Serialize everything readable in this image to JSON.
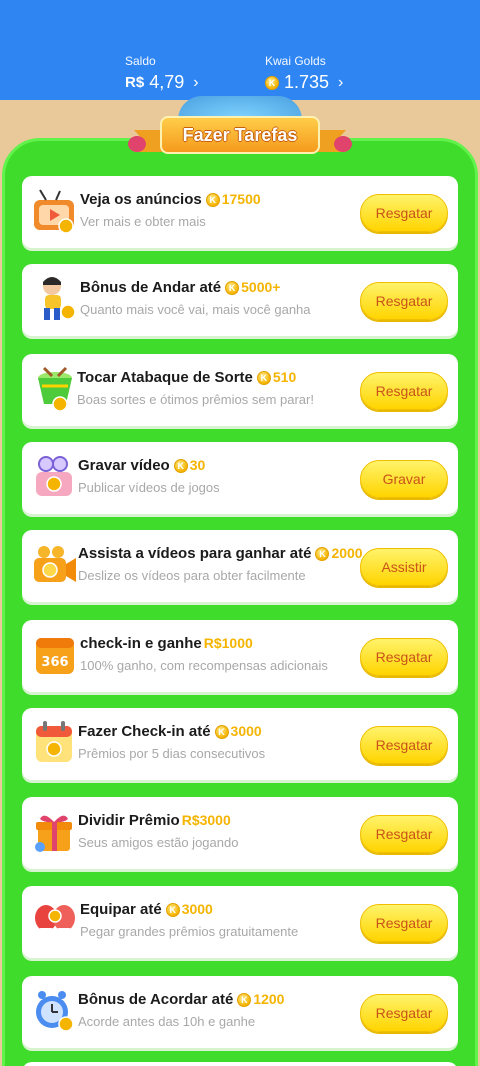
{
  "header": {
    "saldo_label": "Saldo",
    "saldo_currency": "R$",
    "saldo_value": "4,79",
    "golds_label": "Kwai Golds",
    "golds_value": "1.735",
    "chevron": "›"
  },
  "banner": {
    "title": "Fazer Tarefas"
  },
  "coin_glyph": "K",
  "tasks": [
    {
      "title": "Veja os anúncios",
      "reward": "17500",
      "desc": "Ver mais e obter mais",
      "button": "Resgatar",
      "icon": "tv-icon"
    },
    {
      "title": "Bônus de Andar até",
      "reward": "5000+",
      "desc": "Quanto mais você vai, mais você ganha",
      "button": "Resgatar",
      "icon": "runner-icon"
    },
    {
      "title": "Tocar Atabaque de Sorte",
      "reward": "510",
      "desc": "Boas sortes e ótimos prêmios sem parar!",
      "button": "Resgatar",
      "icon": "drum-icon"
    },
    {
      "title": "Gravar vídeo",
      "reward": "30",
      "desc": "Publicar vídeos de jogos",
      "button": "Gravar",
      "icon": "camera-icon"
    },
    {
      "title": "Assista a vídeos para ganhar até",
      "reward": "2000",
      "desc": "Deslize os vídeos para obter facilmente",
      "button": "Assistir",
      "icon": "video-camera-icon"
    },
    {
      "title": "check-in e ganhe",
      "reward": "R$1000",
      "desc": "100% ganho, com recompensas adicionais",
      "button": "Resgatar",
      "icon": "calendar-366-icon"
    },
    {
      "title": "Fazer Check-in até",
      "reward": "3000",
      "desc": "Prêmios por 5 dias consecutivos",
      "button": "Resgatar",
      "icon": "calendar-icon"
    },
    {
      "title": "Dividir Prêmio",
      "reward": "R$3000",
      "desc": "Seus amigos estão jogando",
      "button": "Resgatar",
      "icon": "gift-icon"
    },
    {
      "title": "Equipar até",
      "reward": "3000",
      "desc": "Pegar grandes prêmios gratuitamente",
      "button": "Resgatar",
      "icon": "boxing-gloves-icon"
    },
    {
      "title": "Bônus de Acordar até",
      "reward": "1200",
      "desc": "Acorde antes das 10h e ganhe",
      "button": "Resgatar",
      "icon": "alarm-icon"
    }
  ]
}
